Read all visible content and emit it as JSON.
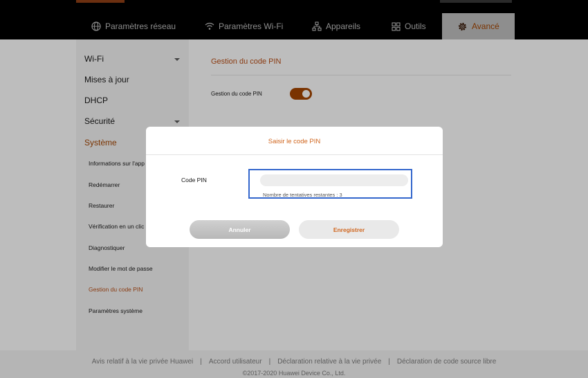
{
  "nav": {
    "tabs": [
      {
        "label": "Paramètres réseau",
        "icon": "globe-icon"
      },
      {
        "label": "Paramètres Wi-Fi",
        "icon": "wifi-icon"
      },
      {
        "label": "Appareils",
        "icon": "devices-icon"
      },
      {
        "label": "Outils",
        "icon": "tools-icon"
      },
      {
        "label": "Avancé",
        "icon": "gear-icon",
        "active": true
      }
    ]
  },
  "sidebar": {
    "items": [
      {
        "label": "Wi-Fi",
        "expandable": true
      },
      {
        "label": "Mises à jour"
      },
      {
        "label": "DHCP"
      },
      {
        "label": "Sécurité",
        "expandable": true
      },
      {
        "label": "Système",
        "active": true
      }
    ],
    "subitems": [
      {
        "label": "Informations sur l'app"
      },
      {
        "label": "Redémarrer"
      },
      {
        "label": "Restaurer"
      },
      {
        "label": "Vérification en un clic"
      },
      {
        "label": "Diagnostiquer"
      },
      {
        "label": "Modifier le mot de passe"
      },
      {
        "label": "Gestion du code PIN",
        "active": true
      },
      {
        "label": "Paramètres système"
      }
    ]
  },
  "main": {
    "section_title": "Gestion du code PIN",
    "toggle_label": "Gestion du code PIN",
    "toggle_on": true
  },
  "modal": {
    "title": "Saisir le code PIN",
    "pin_label": "Code PIN",
    "pin_value": "",
    "attempts_text": "Nombre de tentatives restantes :  3",
    "cancel_label": "Annuler",
    "save_label": "Enregistrer"
  },
  "footer": {
    "links": [
      "Avis relatif à la vie privée Huawei",
      "Accord utilisateur",
      "Déclaration relative à la vie privée",
      "Déclaration de code source libre"
    ],
    "copyright": "©2017-2020 Huawei Device Co., Ltd."
  },
  "colors": {
    "accent": "#d0651d",
    "accent_dark": "#7a3300",
    "overlay_bg": "#bdbdbd",
    "focus_border": "#3366cc"
  }
}
